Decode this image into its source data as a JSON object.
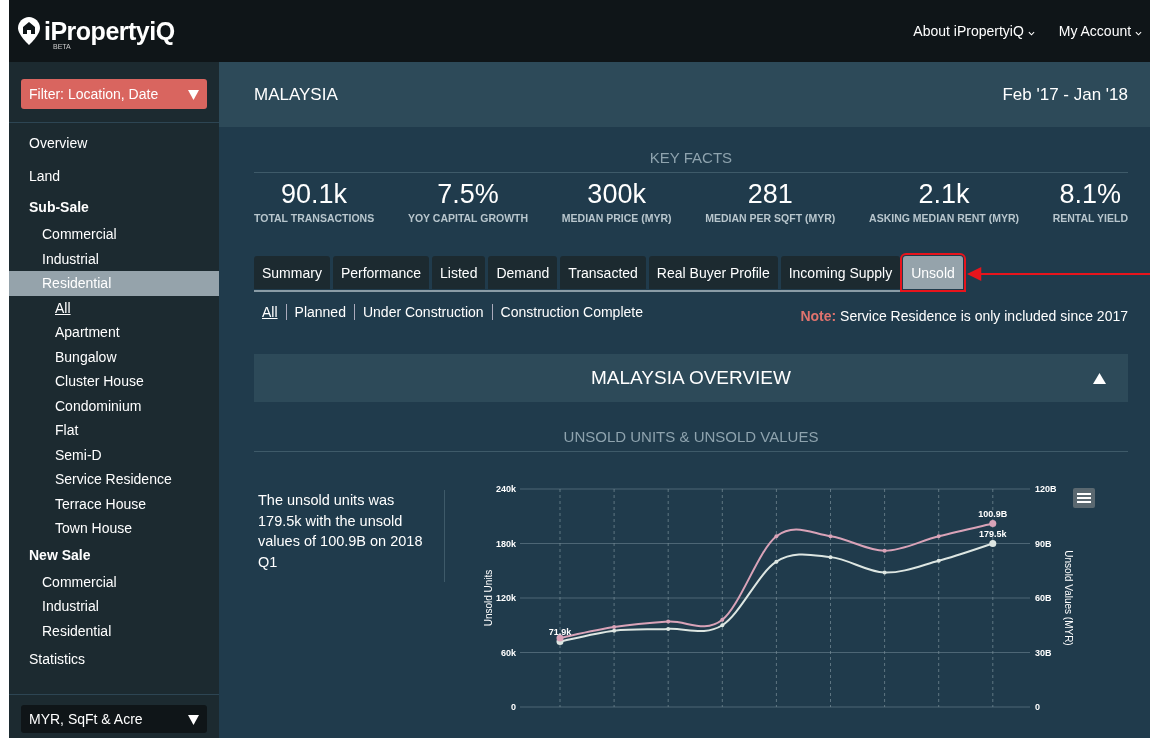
{
  "header": {
    "logo": "iPropertyiQ",
    "logo_badge": "BETA",
    "nav": [
      {
        "label": "About iPropertyiQ"
      },
      {
        "label": "My Account"
      }
    ]
  },
  "sidebar": {
    "filter": "Filter: Location, Date",
    "items": [
      {
        "label": "Overview"
      },
      {
        "label": "Land"
      },
      {
        "label": "Sub-Sale",
        "kind": "heading",
        "children": [
          {
            "label": "Commercial",
            "selected": false
          },
          {
            "label": "Industrial",
            "selected": false
          },
          {
            "label": "Residential",
            "selected": true,
            "children": [
              {
                "label": "All",
                "selected": true
              },
              {
                "label": "Apartment",
                "selected": false
              },
              {
                "label": "Bungalow",
                "selected": false
              },
              {
                "label": "Cluster House",
                "selected": false
              },
              {
                "label": "Condominium",
                "selected": false
              },
              {
                "label": "Flat",
                "selected": false
              },
              {
                "label": "Semi-D",
                "selected": false
              },
              {
                "label": "Service Residence",
                "selected": false
              },
              {
                "label": "Terrace House",
                "selected": false
              },
              {
                "label": "Town House",
                "selected": false
              }
            ]
          }
        ]
      },
      {
        "label": "New Sale",
        "kind": "heading",
        "children": [
          {
            "label": "Commercial",
            "selected": false
          },
          {
            "label": "Industrial",
            "selected": false
          },
          {
            "label": "Residential",
            "selected": false
          }
        ]
      },
      {
        "label": "Statistics"
      }
    ],
    "units": "MYR, SqFt & Acre"
  },
  "title_bar": {
    "location": "MALAYSIA",
    "period": "Feb '17 - Jan '18"
  },
  "key_facts": {
    "title": "KEY FACTS",
    "items": [
      {
        "value": "90.1k",
        "label": "TOTAL TRANSACTIONS"
      },
      {
        "value": "7.5%",
        "label": "YOY CAPITAL GROWTH"
      },
      {
        "value": "300k",
        "label": "MEDIAN PRICE (MYR)"
      },
      {
        "value": "281",
        "label": "MEDIAN PER SQFT (MYR)"
      },
      {
        "value": "2.1k",
        "label": "ASKING MEDIAN RENT (MYR)"
      },
      {
        "value": "8.1%",
        "label": "RENTAL YIELD"
      }
    ]
  },
  "tabs": [
    {
      "label": "Summary",
      "selected": false
    },
    {
      "label": "Performance",
      "selected": false
    },
    {
      "label": "Listed",
      "selected": false
    },
    {
      "label": "Demand",
      "selected": false
    },
    {
      "label": "Transacted",
      "selected": false
    },
    {
      "label": "Real Buyer Profile",
      "selected": false
    },
    {
      "label": "Incoming Supply",
      "selected": false
    },
    {
      "label": "Unsold",
      "selected": true
    }
  ],
  "subtabs": [
    {
      "label": "All",
      "selected": true
    },
    {
      "label": "Planned",
      "selected": false
    },
    {
      "label": "Under Construction",
      "selected": false
    },
    {
      "label": "Construction Complete",
      "selected": false
    }
  ],
  "note": {
    "label": "Note:",
    "text": "Service Residence is only included since 2017"
  },
  "section": {
    "title": "MALAYSIA OVERVIEW",
    "expanded": true
  },
  "chart": {
    "title": "UNSOLD UNITS & UNSOLD VALUES",
    "summary": "The unsold units was 179.5k with the unsold values of 100.9B on 2018 Q1",
    "chart_data": {
      "type": "line",
      "ylabel": "Unsold Units",
      "ylim": [
        0,
        240000
      ],
      "yticks": [
        {
          "value": 0,
          "label": "0"
        },
        {
          "value": 60000,
          "label": "60k"
        },
        {
          "value": 120000,
          "label": "120k"
        },
        {
          "value": 180000,
          "label": "180k"
        },
        {
          "value": 240000,
          "label": "240k"
        }
      ],
      "y2label": "Unsold Values (MYR)",
      "y2lim": [
        0,
        120
      ],
      "y2ticks": [
        {
          "value": 0,
          "label": "0"
        },
        {
          "value": 30,
          "label": "30B"
        },
        {
          "value": 60,
          "label": "60B"
        },
        {
          "value": 90,
          "label": "90B"
        },
        {
          "value": 120,
          "label": "120B"
        }
      ],
      "series": [
        {
          "color": "#dde6e2",
          "values": [
            72000,
            84000,
            86000,
            90000,
            160000,
            165000,
            148000,
            161000,
            180000
          ]
        },
        {
          "color": "#d9a3b8",
          "axis": "y2",
          "values": [
            38,
            44,
            47,
            48,
            94,
            94,
            86,
            94,
            101
          ]
        }
      ],
      "grid": true,
      "annotations": [
        "71.9k",
        "100.9B",
        "179.5k"
      ]
    }
  }
}
